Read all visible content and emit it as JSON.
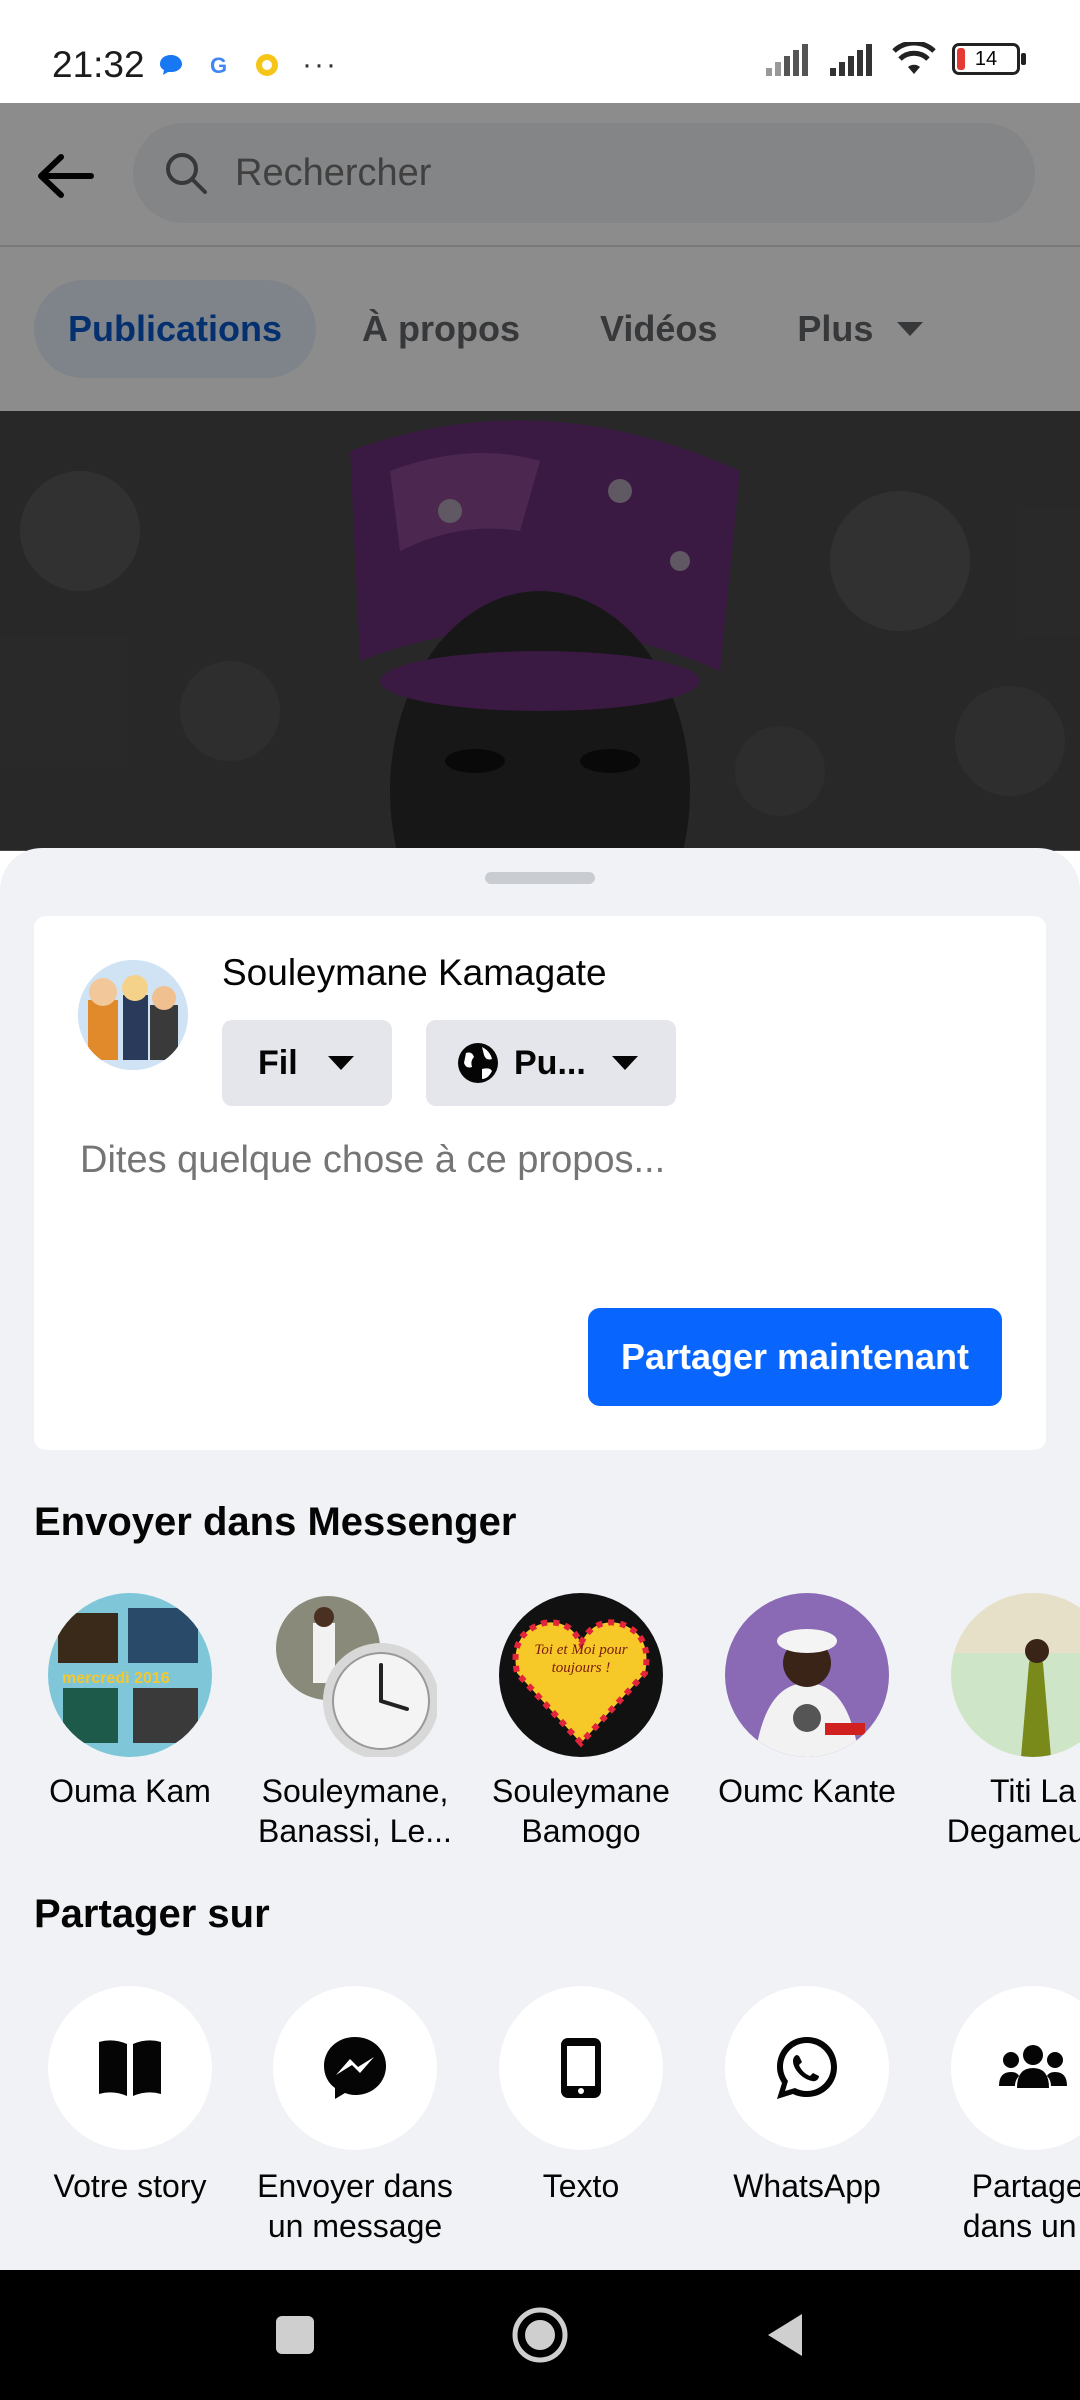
{
  "status_bar": {
    "time": "21:32",
    "battery": "14",
    "icons": [
      "messenger-bubble-icon",
      "google-icon",
      "coin-icon",
      "more-dots-icon",
      "signal-icon",
      "signal-icon",
      "wifi-icon",
      "battery-icon"
    ],
    "more": "···"
  },
  "header": {
    "search_placeholder": "Rechercher"
  },
  "tabs": [
    {
      "label": "Publications",
      "active": true
    },
    {
      "label": "À propos",
      "active": false
    },
    {
      "label": "Vidéos",
      "active": false
    },
    {
      "label": "Plus",
      "active": false
    }
  ],
  "composer": {
    "user_name": "Souleymane Kamagate",
    "destination": "Fil",
    "audience": "Pu...",
    "placeholder": "Dites quelque chose à ce propos...",
    "share_button": "Partager maintenant"
  },
  "messenger": {
    "title": "Envoyer dans Messenger",
    "contacts": [
      {
        "line1": "Ouma Kam",
        "line2": ""
      },
      {
        "line1": "Souleymane,",
        "line2": "Banassi, Le..."
      },
      {
        "line1": "Souleymane",
        "line2": "Bamogo"
      },
      {
        "line1": "Oumc Kante",
        "line2": ""
      },
      {
        "line1": "Titi La",
        "line2": "Degameuse"
      }
    ],
    "heart_text": "Toi et Moi pour toujours !",
    "collage_text": "mercredi 2016"
  },
  "share_on": {
    "title": "Partager sur",
    "items": [
      {
        "line1": "Votre story",
        "line2": "",
        "icon": "book-icon"
      },
      {
        "line1": "Envoyer dans",
        "line2": "un message",
        "icon": "messenger-icon"
      },
      {
        "line1": "Texto",
        "line2": "",
        "icon": "phone-icon"
      },
      {
        "line1": "WhatsApp",
        "line2": "",
        "icon": "whatsapp-icon"
      },
      {
        "line1": "Partager",
        "line2": "dans un g",
        "icon": "group-icon"
      }
    ]
  },
  "colors": {
    "accent": "#0866ff",
    "tab_active_bg": "#e7f0fd",
    "tab_active_text": "#0a58ca",
    "sheet_bg": "#f0f2f5"
  }
}
